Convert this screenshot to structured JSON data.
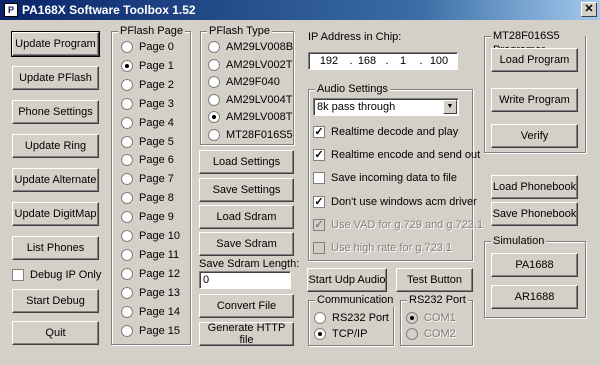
{
  "window": {
    "title": "PA168X Software Toolbox 1.52",
    "app_icon": "app-logo-icon",
    "close_label": "✕"
  },
  "left_buttons": {
    "update_program": "Update Program",
    "update_pflash": "Update PFlash",
    "phone_settings": "Phone Settings",
    "update_ring": "Update Ring",
    "update_alternate": "Update Alternate",
    "update_digitmap": "Update DigitMap",
    "list_phones": "List Phones",
    "debug_ip_only": "Debug IP Only",
    "start_debug": "Start Debug",
    "quit": "Quit"
  },
  "pflash_page": {
    "title": "PFlash Page",
    "selected": "Page 1",
    "pages": [
      "Page 0",
      "Page 1",
      "Page 2",
      "Page 3",
      "Page 4",
      "Page 5",
      "Page 6",
      "Page 7",
      "Page 8",
      "Page 9",
      "Page 10",
      "Page 11",
      "Page 12",
      "Page 13",
      "Page 14",
      "Page 15"
    ]
  },
  "pflash_type": {
    "title": "PFlash Type",
    "selected": "AM29LV008T",
    "types": [
      "AM29LV008B",
      "AM29LV002T",
      "AM29F040",
      "AM29LV004T",
      "AM29LV008T",
      "MT28F016S5"
    ]
  },
  "middle_buttons": {
    "load_settings": "Load Settings",
    "save_settings": "Save Settings",
    "load_sdram": "Load Sdram",
    "save_sdram": "Save Sdram",
    "save_sdram_length_label": "Save Sdram Length:",
    "save_sdram_length_value": "0",
    "convert_file": "Convert File",
    "generate_http": "Generate HTTP file"
  },
  "ip": {
    "label": "IP Address in Chip:",
    "octets": [
      "192",
      "168",
      "1",
      "100"
    ],
    "dot": "."
  },
  "audio": {
    "title": "Audio Settings",
    "mode": "8k pass through",
    "arrow": "▼",
    "options": [
      {
        "label": "Realtime decode and play",
        "checked": true,
        "enabled": true
      },
      {
        "label": "Realtime encode and send out",
        "checked": true,
        "enabled": true
      },
      {
        "label": "Save incoming data to file",
        "checked": false,
        "enabled": true
      },
      {
        "label": "Don't use windows acm driver",
        "checked": true,
        "enabled": true
      },
      {
        "label": "Use VAD for g.729 and g.723.1",
        "checked": true,
        "enabled": false
      },
      {
        "label": "Use high rate for g.723.1",
        "checked": false,
        "enabled": false
      }
    ],
    "check_mark": "✓"
  },
  "udp": {
    "start_udp_audio": "Start Udp Audio",
    "test_button": "Test Button"
  },
  "communication": {
    "title": "Communication",
    "selected": "TCP/IP",
    "options": [
      "RS232 Port",
      "TCP/IP"
    ]
  },
  "rs232": {
    "title": "RS232 Port",
    "selected": "COM1",
    "options": [
      "COM1",
      "COM2"
    ]
  },
  "mt28": {
    "title": "MT28F016S5 Programer",
    "load_program": "Load Program",
    "write_program": "Write Program",
    "verify": "Verify"
  },
  "phonebook": {
    "load": "Load Phonebook",
    "save": "Save Phonebook"
  },
  "simulation": {
    "title": "Simulation",
    "pa1688": "PA1688",
    "ar1688": "AR1688"
  }
}
